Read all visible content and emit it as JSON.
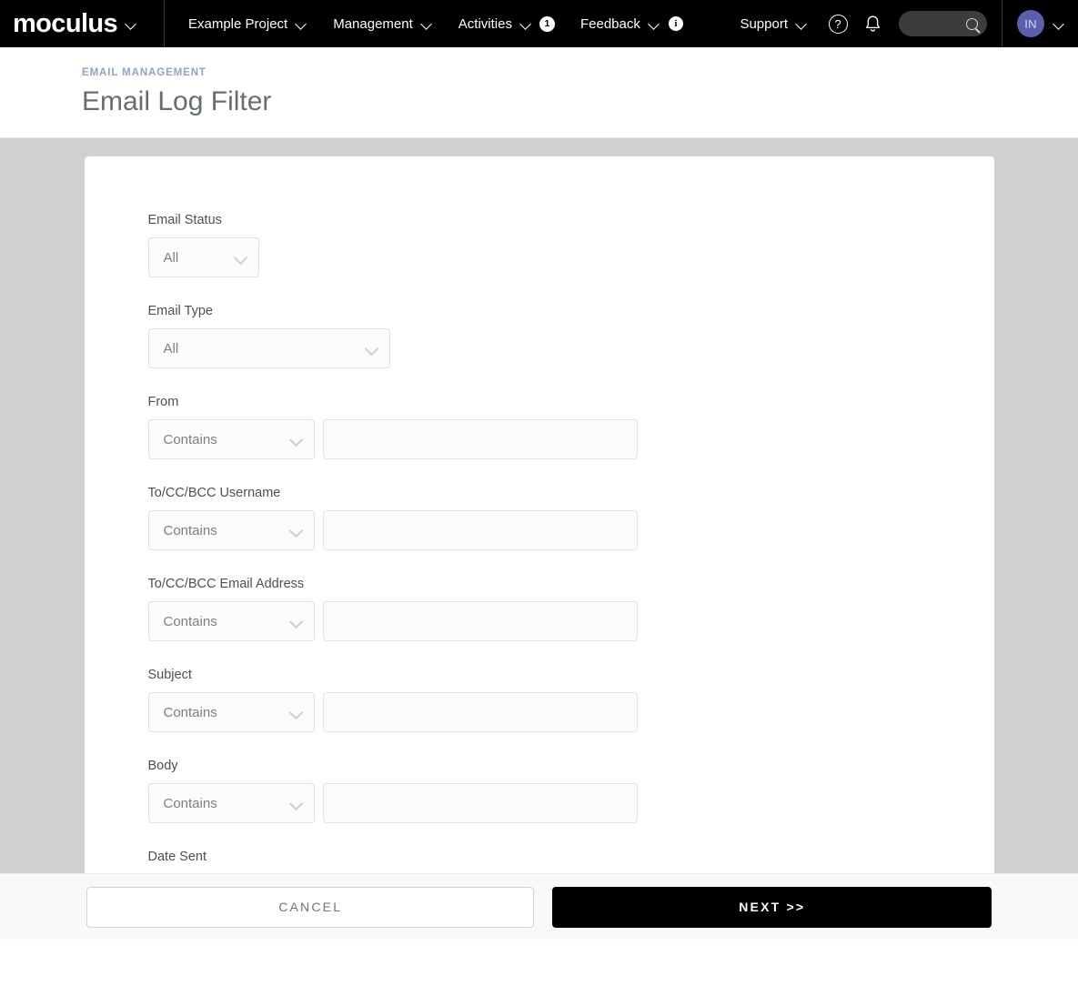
{
  "navbar": {
    "brand": "moculus",
    "items": [
      {
        "label": "Example Project",
        "chevron": true
      },
      {
        "label": "Management",
        "chevron": true
      },
      {
        "label": "Activities",
        "chevron": true,
        "badge": "1"
      },
      {
        "label": "Feedback",
        "chevron": true,
        "info": "i"
      }
    ],
    "support": "Support",
    "help_icon": "?",
    "bell_icon": "notification-bell",
    "search_placeholder": "",
    "avatar_initials": "IN",
    "accent_avatar_color": "#5b5fad",
    "background_color": "#000000"
  },
  "header": {
    "breadcrumb": "EMAIL MANAGEMENT",
    "title": "Email Log Filter",
    "breadcrumb_color": "#8fa4c6"
  },
  "form": {
    "fields": [
      {
        "label": "Email Status",
        "type": "select",
        "value": "All",
        "width": "sm"
      },
      {
        "label": "Email Type",
        "type": "select",
        "value": "All",
        "width": "md"
      },
      {
        "label": "From",
        "type": "operator-text",
        "operator": "Contains",
        "value": "",
        "placeholder": ""
      },
      {
        "label": "To/CC/BCC Username",
        "type": "operator-text",
        "operator": "Contains",
        "value": "",
        "placeholder": ""
      },
      {
        "label": "To/CC/BCC Email Address",
        "type": "operator-text",
        "operator": "Contains",
        "value": "",
        "placeholder": ""
      },
      {
        "label": "Subject",
        "type": "operator-text",
        "operator": "Contains",
        "value": "",
        "placeholder": ""
      },
      {
        "label": "Body",
        "type": "operator-text",
        "operator": "Contains",
        "value": "",
        "placeholder": ""
      },
      {
        "label": "Date Sent",
        "type": "label-only"
      }
    ]
  },
  "footer": {
    "cancel_label": "CANCEL",
    "next_label": "NEXT >>"
  }
}
